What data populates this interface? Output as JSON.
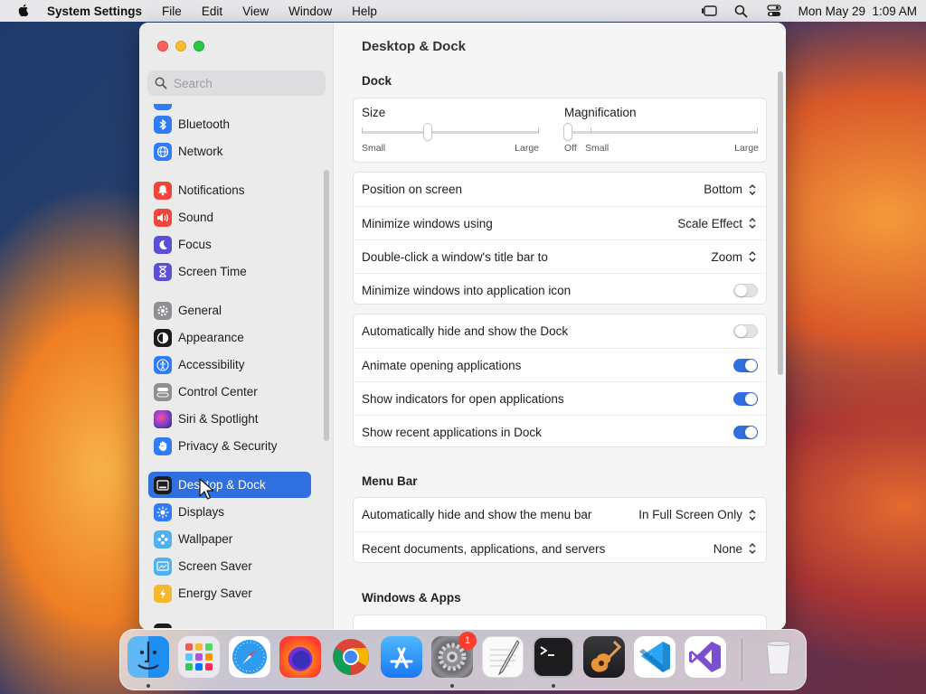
{
  "menubar": {
    "app_name": "System Settings",
    "menus": [
      "File",
      "Edit",
      "View",
      "Window",
      "Help"
    ],
    "clock": "Mon May 29  1:09 AM"
  },
  "search": {
    "placeholder": "Search"
  },
  "sidebar": {
    "items": [
      {
        "label": "Bluetooth",
        "icon": "bluetooth-icon",
        "color": "#2f7cf6"
      },
      {
        "label": "Network",
        "icon": "globe-icon",
        "color": "#2f7cf6"
      },
      {
        "label": "Notifications",
        "icon": "bell-icon",
        "color": "#f0453a"
      },
      {
        "label": "Sound",
        "icon": "speaker-icon",
        "color": "#f0453a"
      },
      {
        "label": "Focus",
        "icon": "moon-icon",
        "color": "#5b4fd6"
      },
      {
        "label": "Screen Time",
        "icon": "hourglass-icon",
        "color": "#5b4fd6"
      },
      {
        "label": "General",
        "icon": "gear-icon",
        "color": "#8e8e93"
      },
      {
        "label": "Appearance",
        "icon": "appearance-icon",
        "color": "#1c1c1e"
      },
      {
        "label": "Accessibility",
        "icon": "accessibility-icon",
        "color": "#2f7cf6"
      },
      {
        "label": "Control Center",
        "icon": "control-center-icon",
        "color": "#8e8e93"
      },
      {
        "label": "Siri & Spotlight",
        "icon": "siri-icon",
        "color": "#7b3ec9"
      },
      {
        "label": "Privacy & Security",
        "icon": "hand-icon",
        "color": "#2f7cf6"
      },
      {
        "label": "Desktop & Dock",
        "icon": "desktop-dock-icon",
        "color": "#1c1c1e"
      },
      {
        "label": "Displays",
        "icon": "sun-icon",
        "color": "#2f7cf6"
      },
      {
        "label": "Wallpaper",
        "icon": "wallpaper-icon",
        "color": "#4eb2f0"
      },
      {
        "label": "Screen Saver",
        "icon": "screen-saver-icon",
        "color": "#4eb2f0"
      },
      {
        "label": "Energy Saver",
        "icon": "battery-icon",
        "color": "#f5b72b"
      }
    ]
  },
  "content": {
    "title": "Desktop & Dock",
    "dock_section": "Dock",
    "size_label": "Size",
    "size_small": "Small",
    "size_large": "Large",
    "size_value": 0.37,
    "mag_label": "Magnification",
    "mag_off": "Off",
    "mag_small": "Small",
    "mag_large": "Large",
    "mag_value": 0.0,
    "position_label": "Position on screen",
    "position_value": "Bottom",
    "minimize_label": "Minimize windows using",
    "minimize_value": "Scale Effect",
    "doubleclick_label": "Double-click a window's title bar to",
    "doubleclick_value": "Zoom",
    "minimize_icon_label": "Minimize windows into application icon",
    "autohide_label": "Automatically hide and show the Dock",
    "animate_label": "Animate opening applications",
    "indicators_label": "Show indicators for open applications",
    "recent_label": "Show recent applications in Dock",
    "menubar_section": "Menu Bar",
    "menubar_autohide_label": "Automatically hide and show the menu bar",
    "menubar_autohide_value": "In Full Screen Only",
    "recent_docs_label": "Recent documents, applications, and servers",
    "recent_docs_value": "None",
    "windows_section": "Windows & Apps"
  },
  "dock": {
    "apps": [
      "Finder",
      "Launchpad",
      "Safari",
      "Firefox",
      "Chrome",
      "App Store",
      "System Settings",
      "TextEdit",
      "Terminal",
      "GarageBand",
      "Visual Studio Code",
      "Visual Studio",
      "Trash"
    ],
    "settings_badge": "1"
  }
}
